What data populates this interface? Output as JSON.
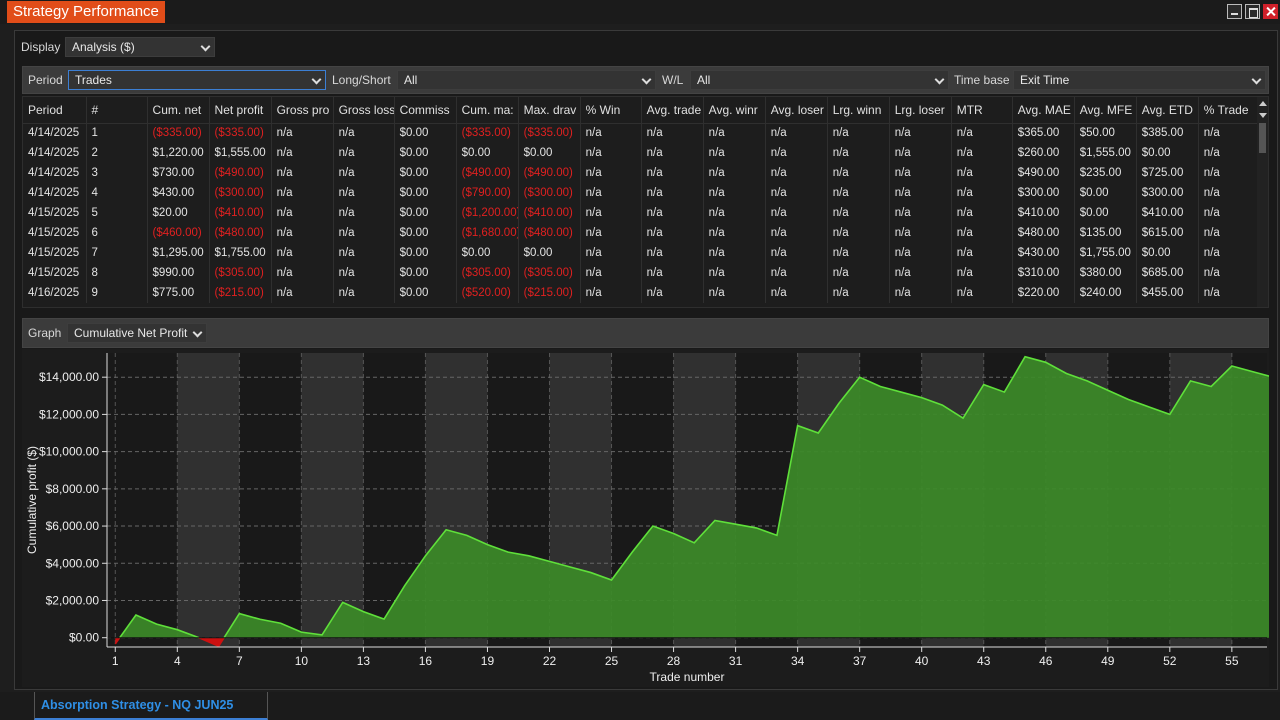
{
  "window": {
    "title": "Strategy Performance"
  },
  "display": {
    "label": "Display",
    "value": "Analysis ($)"
  },
  "filters": {
    "period_label": "Period",
    "period_value": "Trades",
    "longshort_label": "Long/Short",
    "longshort_value": "All",
    "wl_label": "W/L",
    "wl_value": "All",
    "timebase_label": "Time base",
    "timebase_value": "Exit Time"
  },
  "table": {
    "columns": [
      "Period",
      "#",
      "Cum. net",
      "Net profit",
      "Gross pro",
      "Gross loss",
      "Commiss",
      "Cum. ma:",
      "Max. drav",
      "% Win",
      "Avg. trade",
      "Avg. winr",
      "Avg. loser",
      "Lrg. winn",
      "Lrg. loser",
      "MTR",
      "Avg. MAE",
      "Avg. MFE",
      "Avg. ETD",
      "% Trade"
    ],
    "rows": [
      [
        "4/14/2025",
        "1",
        "($335.00)",
        "($335.00)",
        "n/a",
        "n/a",
        "$0.00",
        "($335.00)",
        "($335.00)",
        "n/a",
        "n/a",
        "n/a",
        "n/a",
        "n/a",
        "n/a",
        "n/a",
        "$365.00",
        "$50.00",
        "$385.00",
        "n/a"
      ],
      [
        "4/14/2025",
        "2",
        "$1,220.00",
        "$1,555.00",
        "n/a",
        "n/a",
        "$0.00",
        "$0.00",
        "$0.00",
        "n/a",
        "n/a",
        "n/a",
        "n/a",
        "n/a",
        "n/a",
        "n/a",
        "$260.00",
        "$1,555.00",
        "$0.00",
        "n/a"
      ],
      [
        "4/14/2025",
        "3",
        "$730.00",
        "($490.00)",
        "n/a",
        "n/a",
        "$0.00",
        "($490.00)",
        "($490.00)",
        "n/a",
        "n/a",
        "n/a",
        "n/a",
        "n/a",
        "n/a",
        "n/a",
        "$490.00",
        "$235.00",
        "$725.00",
        "n/a"
      ],
      [
        "4/14/2025",
        "4",
        "$430.00",
        "($300.00)",
        "n/a",
        "n/a",
        "$0.00",
        "($790.00)",
        "($300.00)",
        "n/a",
        "n/a",
        "n/a",
        "n/a",
        "n/a",
        "n/a",
        "n/a",
        "$300.00",
        "$0.00",
        "$300.00",
        "n/a"
      ],
      [
        "4/15/2025",
        "5",
        "$20.00",
        "($410.00)",
        "n/a",
        "n/a",
        "$0.00",
        "($1,200.00)",
        "($410.00)",
        "n/a",
        "n/a",
        "n/a",
        "n/a",
        "n/a",
        "n/a",
        "n/a",
        "$410.00",
        "$0.00",
        "$410.00",
        "n/a"
      ],
      [
        "4/15/2025",
        "6",
        "($460.00)",
        "($480.00)",
        "n/a",
        "n/a",
        "$0.00",
        "($1,680.00)",
        "($480.00)",
        "n/a",
        "n/a",
        "n/a",
        "n/a",
        "n/a",
        "n/a",
        "n/a",
        "$480.00",
        "$135.00",
        "$615.00",
        "n/a"
      ],
      [
        "4/15/2025",
        "7",
        "$1,295.00",
        "$1,755.00",
        "n/a",
        "n/a",
        "$0.00",
        "$0.00",
        "$0.00",
        "n/a",
        "n/a",
        "n/a",
        "n/a",
        "n/a",
        "n/a",
        "n/a",
        "$430.00",
        "$1,755.00",
        "$0.00",
        "n/a"
      ],
      [
        "4/15/2025",
        "8",
        "$990.00",
        "($305.00)",
        "n/a",
        "n/a",
        "$0.00",
        "($305.00)",
        "($305.00)",
        "n/a",
        "n/a",
        "n/a",
        "n/a",
        "n/a",
        "n/a",
        "n/a",
        "$310.00",
        "$380.00",
        "$685.00",
        "n/a"
      ],
      [
        "4/16/2025",
        "9",
        "$775.00",
        "($215.00)",
        "n/a",
        "n/a",
        "$0.00",
        "($520.00)",
        "($215.00)",
        "n/a",
        "n/a",
        "n/a",
        "n/a",
        "n/a",
        "n/a",
        "n/a",
        "$220.00",
        "$240.00",
        "$455.00",
        "n/a"
      ]
    ]
  },
  "graph": {
    "label": "Graph",
    "value": "Cumulative Net Profit"
  },
  "colors": {
    "fill_positive": "#3c8a28",
    "line_positive": "#5fe03a",
    "fill_negative": "#cc1111",
    "accent": "#e14d19",
    "negative_text": "#e02020"
  },
  "chart_data": {
    "type": "area",
    "xlabel": "Trade number",
    "ylabel": "Cumulative profit ($)",
    "xlim": [
      0.6,
      56.7
    ],
    "ylim": [
      -500,
      15300
    ],
    "x_ticks": [
      1,
      4,
      7,
      10,
      13,
      16,
      19,
      22,
      25,
      28,
      31,
      34,
      37,
      40,
      43,
      46,
      49,
      52,
      55
    ],
    "y_ticks": [
      0,
      2000,
      4000,
      6000,
      8000,
      10000,
      12000,
      14000
    ],
    "y_tick_labels": [
      "$0.00",
      "$2,000.00",
      "$4,000.00",
      "$6,000.00",
      "$8,000.00",
      "$10,000.00",
      "$12,000.00",
      "$14,000.00"
    ],
    "grid": true,
    "series": [
      {
        "values": [
          -335,
          1220,
          730,
          430,
          20,
          -460,
          1295,
          990,
          775,
          300,
          150,
          1900,
          1400,
          1000,
          2800,
          4400,
          5800,
          5500,
          5000,
          4600,
          4400,
          4100,
          3800,
          3500,
          3100,
          4600,
          6000,
          5600,
          5100,
          6300,
          6100,
          5900,
          5500,
          11400,
          11000,
          12600,
          14000,
          13500,
          13200,
          12900,
          12500,
          11800,
          13600,
          13200,
          15100,
          14800,
          14200,
          13800,
          13300,
          12800,
          12400,
          12000,
          13800,
          13500,
          14600,
          14300,
          14000
        ]
      }
    ]
  },
  "taskbar": {
    "tab": "Absorption Strategy - NQ JUN25"
  }
}
